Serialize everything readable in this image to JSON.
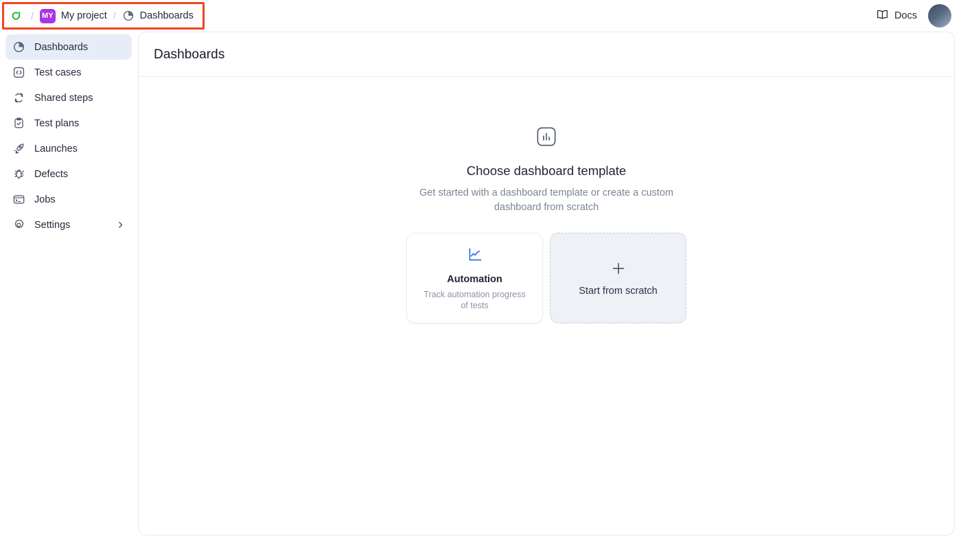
{
  "header": {
    "logo_icon": "axe-logo-icon",
    "separator": "/",
    "project_badge": "MY",
    "project_name": "My project",
    "section_icon": "pie-chart-icon",
    "section_name": "Dashboards",
    "docs_label": "Docs",
    "docs_icon": "book-icon",
    "avatar_icon": "user-avatar",
    "annotation_color": "#f0441f"
  },
  "sidebar": {
    "items": [
      {
        "label": "Dashboards",
        "icon": "pie-chart-icon",
        "active": true,
        "chevron": ""
      },
      {
        "label": "Test cases",
        "icon": "code-icon",
        "active": false,
        "chevron": ""
      },
      {
        "label": "Shared steps",
        "icon": "refresh-icon",
        "active": false,
        "chevron": ""
      },
      {
        "label": "Test plans",
        "icon": "clipboard-check-icon",
        "active": false,
        "chevron": ""
      },
      {
        "label": "Launches",
        "icon": "rocket-icon",
        "active": false,
        "chevron": ""
      },
      {
        "label": "Defects",
        "icon": "bug-icon",
        "active": false,
        "chevron": ""
      },
      {
        "label": "Jobs",
        "icon": "terminal-icon",
        "active": false,
        "chevron": ""
      },
      {
        "label": "Settings",
        "icon": "gear-icon",
        "active": false,
        "chevron": "chevron-right-icon"
      }
    ]
  },
  "main": {
    "page_title": "Dashboards",
    "empty_state": {
      "icon": "bar-chart-icon",
      "title": "Choose dashboard template",
      "subtitle": "Get started with a dashboard template or create a custom dashboard from scratch"
    },
    "cards": [
      {
        "type": "template",
        "icon": "line-chart-icon",
        "title": "Automation",
        "description": "Track automation progress of tests",
        "accent": "#2f6bea"
      },
      {
        "type": "scratch",
        "icon": "plus-icon",
        "title": "Start from scratch",
        "description": ""
      }
    ]
  }
}
